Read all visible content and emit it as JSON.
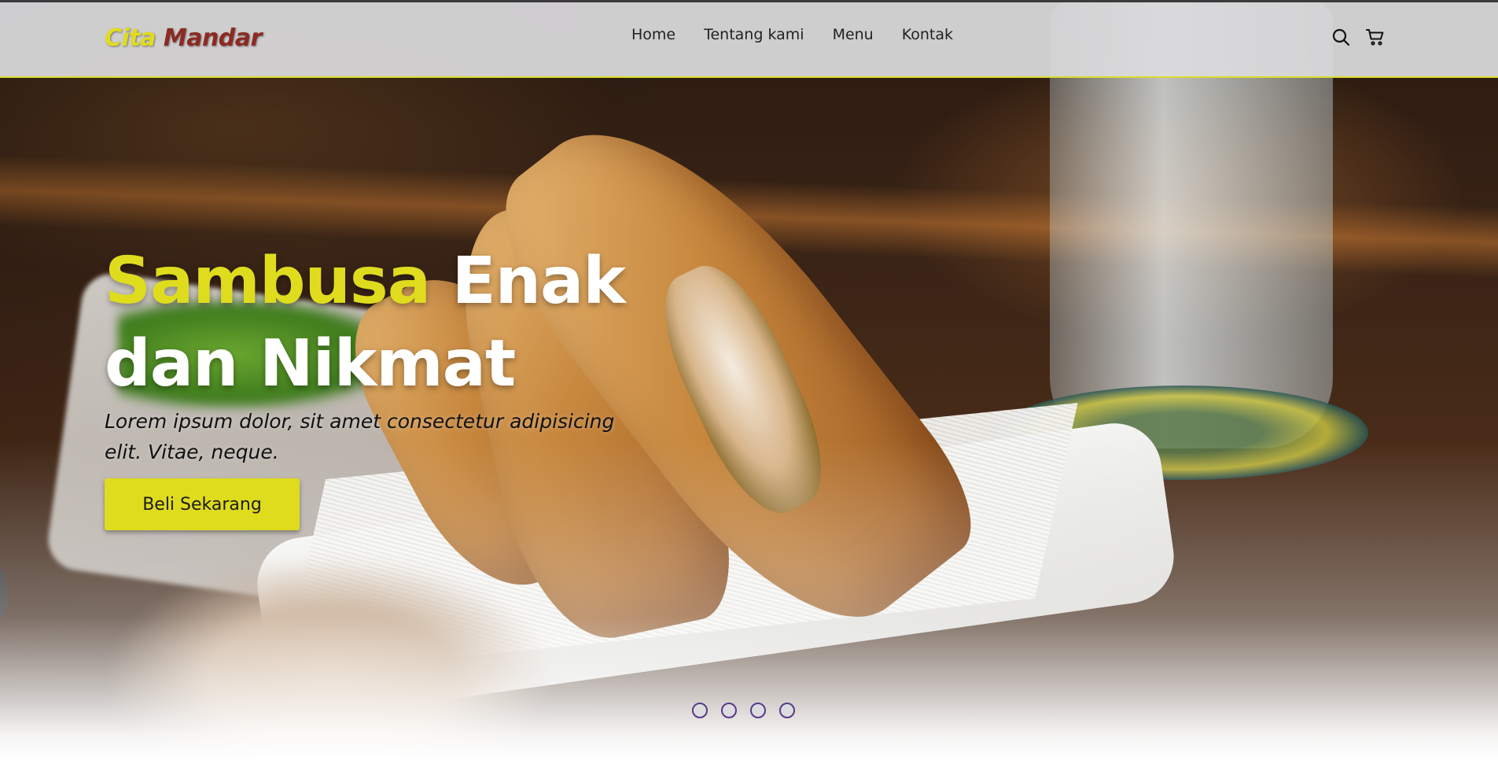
{
  "brand": {
    "part1": "Cita",
    "part2": "Mandar"
  },
  "nav": {
    "items": [
      "Home",
      "Tentang kami",
      "Menu",
      "Kontak"
    ]
  },
  "hero": {
    "headline_accent": "Sambusa",
    "headline_rest": " Enak",
    "headline_line2": "dan Nikmat",
    "subtitle": "Lorem ipsum dolor, sit amet consectetur adipisicing elit. Vitae, neque.",
    "cta_label": "Beli Sekarang",
    "slide_count": 4
  },
  "icons": {
    "search": "search-icon",
    "cart": "cart-icon"
  },
  "colors": {
    "accent": "#dfdc1e",
    "brand_red": "#8c2a22",
    "nav_underline": "#d9dc2c",
    "dot_border": "#5a3a8a"
  }
}
